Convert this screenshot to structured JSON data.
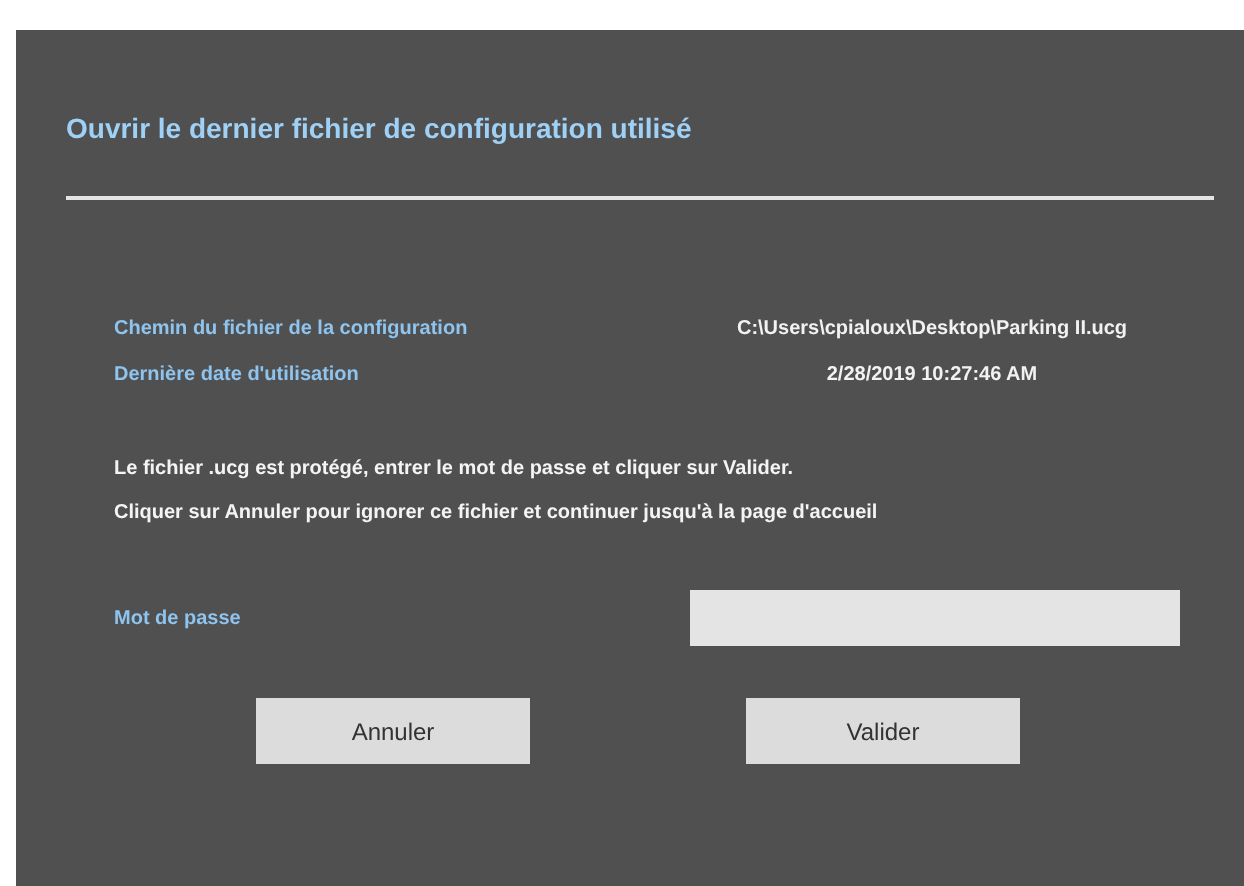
{
  "dialog": {
    "title": "Ouvrir le dernier fichier de configuration utilisé"
  },
  "info_rows": [
    {
      "label": "Chemin du fichier de la configuration",
      "value": "C:\\Users\\cpialoux\\Desktop\\Parking II.ucg"
    },
    {
      "label": "Dernière date d'utilisation",
      "value": "2/28/2019 10:27:46 AM"
    }
  ],
  "messages": [
    "Le fichier .ucg est protégé, entrer le mot de passe et cliquer sur Valider.",
    "Cliquer sur Annuler pour ignorer ce fichier et continuer jusqu'à la page d'accueil"
  ],
  "password": {
    "label": "Mot de passe"
  },
  "buttons": [
    "Annuler",
    "Valider"
  ]
}
